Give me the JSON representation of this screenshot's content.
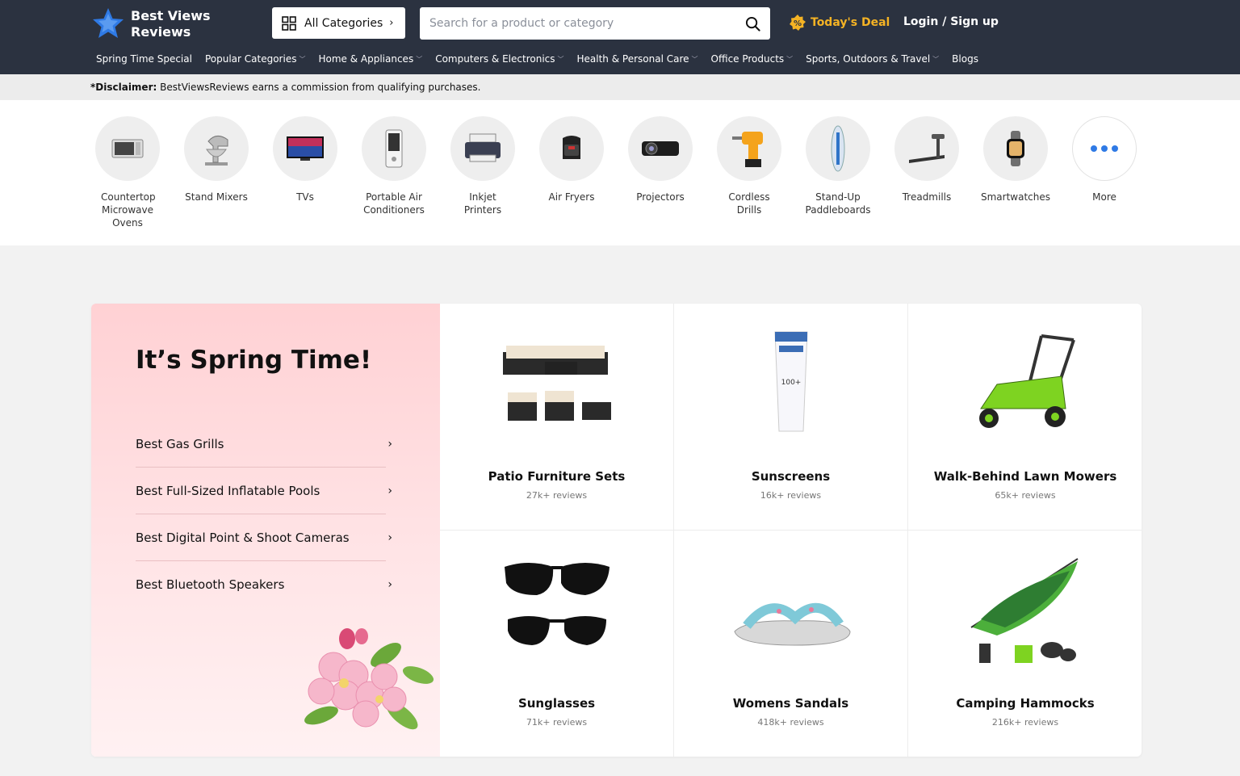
{
  "header": {
    "logo_line1": "Best Views",
    "logo_line2": "Reviews",
    "all_categories": "All Categories",
    "search_placeholder": "Search for a product or category",
    "todays_deal": "Today's Deal",
    "login": "Login / Sign up"
  },
  "nav": [
    {
      "label": "Spring Time Special",
      "dropdown": false
    },
    {
      "label": "Popular Categories",
      "dropdown": true
    },
    {
      "label": "Home & Appliances",
      "dropdown": true
    },
    {
      "label": "Computers & Electronics",
      "dropdown": true
    },
    {
      "label": "Health & Personal Care",
      "dropdown": true
    },
    {
      "label": "Office Products",
      "dropdown": true
    },
    {
      "label": "Sports, Outdoors & Travel",
      "dropdown": true
    },
    {
      "label": "Blogs",
      "dropdown": false
    }
  ],
  "disclaimer": {
    "label": "*Disclaimer:",
    "text": "BestViewsReviews earns a commission from qualifying purchases."
  },
  "categories": [
    {
      "label": "Countertop Microwave Ovens",
      "icon": "microwave-icon"
    },
    {
      "label": "Stand Mixers",
      "icon": "stand-mixer-icon"
    },
    {
      "label": "TVs",
      "icon": "tv-icon"
    },
    {
      "label": "Portable Air Conditioners",
      "icon": "air-conditioner-icon"
    },
    {
      "label": "Inkjet Printers",
      "icon": "printer-icon"
    },
    {
      "label": "Air Fryers",
      "icon": "air-fryer-icon"
    },
    {
      "label": "Projectors",
      "icon": "projector-icon"
    },
    {
      "label": "Cordless Drills",
      "icon": "drill-icon"
    },
    {
      "label": "Stand-Up Paddleboards",
      "icon": "paddleboard-icon"
    },
    {
      "label": "Treadmills",
      "icon": "treadmill-icon"
    },
    {
      "label": "Smartwatches",
      "icon": "smartwatch-icon"
    },
    {
      "label": "More",
      "icon": "more-dots-icon"
    }
  ],
  "spring": {
    "title": "It’s Spring Time!",
    "links": [
      "Best Gas Grills",
      "Best Full-Sized Inflatable Pools",
      "Best Digital Point & Shoot Cameras",
      "Best Bluetooth Speakers"
    ]
  },
  "products": [
    {
      "title": "Patio Furniture Sets",
      "reviews": "27k+ reviews"
    },
    {
      "title": "Sunscreens",
      "reviews": "16k+ reviews"
    },
    {
      "title": "Walk-Behind Lawn Mowers",
      "reviews": "65k+ reviews"
    },
    {
      "title": "Sunglasses",
      "reviews": "71k+ reviews"
    },
    {
      "title": "Womens Sandals",
      "reviews": "418k+ reviews"
    },
    {
      "title": "Camping Hammocks",
      "reviews": "216k+ reviews"
    }
  ],
  "colors": {
    "header_bg": "#2b3240",
    "deal_accent": "#f5b324",
    "logo_blue": "#2f7ae5"
  }
}
